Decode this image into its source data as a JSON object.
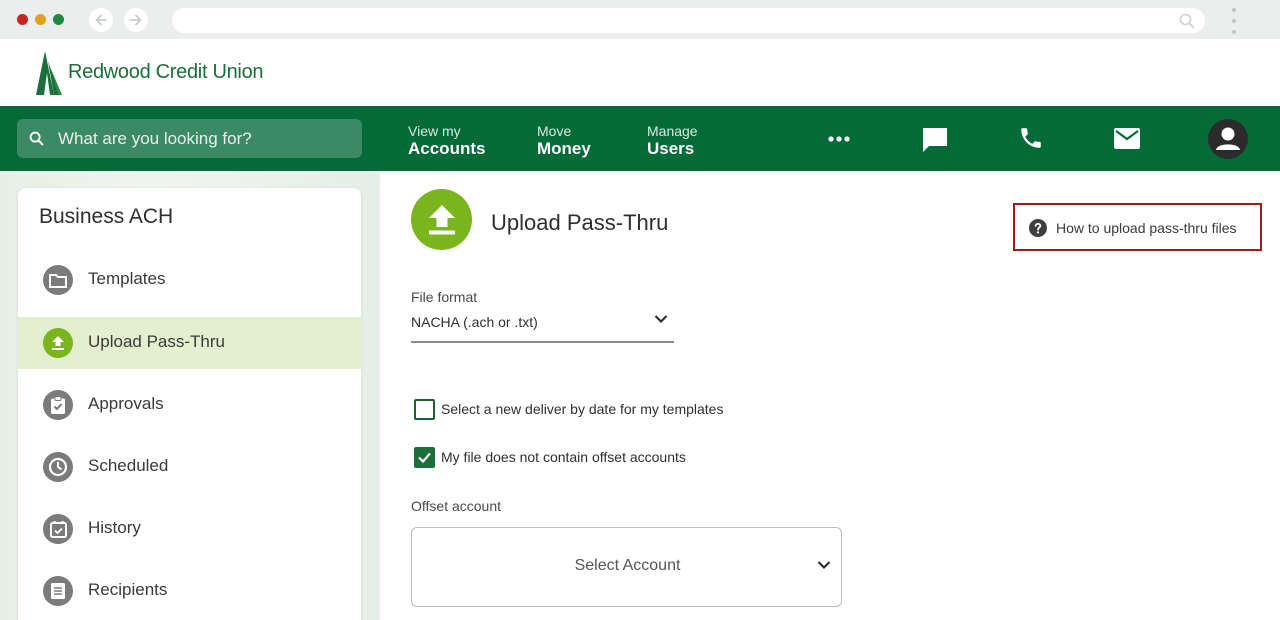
{
  "browser": {
    "dot_colors": [
      "#c8251f",
      "#e2a11c",
      "#1e8a3e"
    ]
  },
  "brand": {
    "name": "Redwood Credit Union",
    "primary_color": "#046a38",
    "accent_color": "#7ab51d"
  },
  "topnav": {
    "search_placeholder": "What are you looking for?",
    "links": [
      {
        "small": "View my",
        "big": "Accounts"
      },
      {
        "small": "Move",
        "big": "Money"
      },
      {
        "small": "Manage",
        "big": "Users"
      }
    ],
    "icons": [
      "more-icon",
      "chat-icon",
      "phone-icon",
      "mail-icon",
      "profile-icon"
    ]
  },
  "sidebar": {
    "title": "Business ACH",
    "items": [
      {
        "label": "Templates",
        "icon": "folder-icon",
        "active": false
      },
      {
        "label": "Upload Pass-Thru",
        "icon": "upload-icon",
        "active": true
      },
      {
        "label": "Approvals",
        "icon": "clipboard-check-icon",
        "active": false
      },
      {
        "label": "Scheduled",
        "icon": "clock-icon",
        "active": false
      },
      {
        "label": "History",
        "icon": "calendar-check-icon",
        "active": false
      },
      {
        "label": "Recipients",
        "icon": "list-icon",
        "active": false
      }
    ]
  },
  "main": {
    "title": "Upload Pass-Thru",
    "help_link": "How to upload pass-thru files",
    "file_format": {
      "label": "File format",
      "value": "NACHA (.ach or .txt)"
    },
    "checkboxes": [
      {
        "label": "Select a new deliver by date for my templates",
        "checked": false
      },
      {
        "label": "My file does not contain offset accounts",
        "checked": true
      }
    ],
    "offset_account": {
      "label": "Offset account",
      "placeholder": "Select Account"
    }
  }
}
